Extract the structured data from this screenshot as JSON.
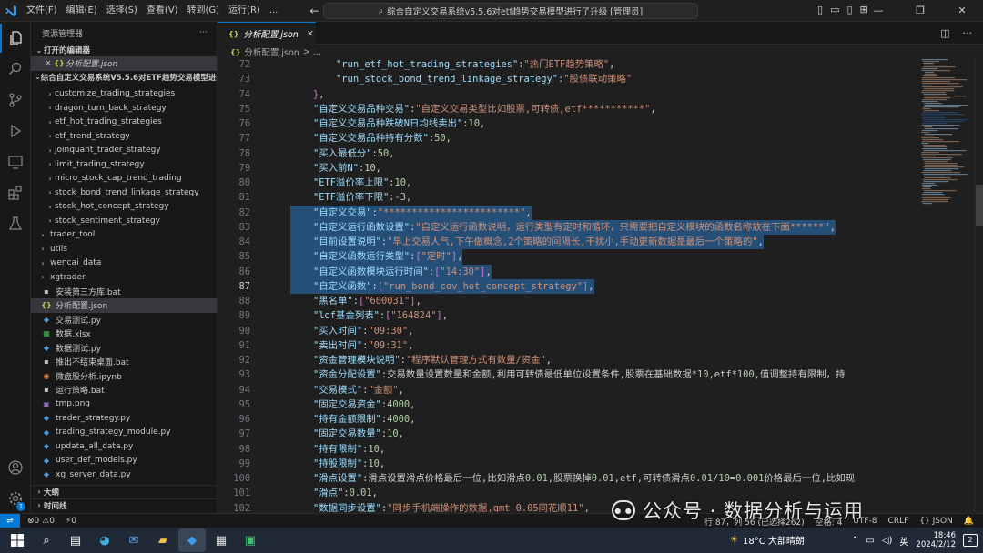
{
  "titlebar": {
    "menu": [
      "文件(F)",
      "编辑(E)",
      "选择(S)",
      "查看(V)",
      "转到(G)",
      "运行(R)",
      "..."
    ],
    "command_center": "综合自定义交易系统v5.5.6对etf趋势交易模型进行了升级 [管理员]"
  },
  "sidebar": {
    "title": "资源管理器",
    "more": "···",
    "open_editors_label": "打开的编辑器",
    "open_editor_file": "分析配置.json",
    "project_label": "综合自定义交易系统V5.5.6对ETF趋势交易模型进行了...",
    "folders": [
      "customize_trading_strategies",
      "dragon_turn_back_strategy",
      "etf_hot_trading_strategies",
      "etf_trend_strategy",
      "joinquant_trader_strategy",
      "limit_trading_strategy",
      "micro_stock_cap_trend_trading",
      "stock_bond_trend_linkage_strategy",
      "stock_hot_concept_strategy",
      "stock_sentiment_strategy"
    ],
    "root_items": [
      {
        "name": "trader_tool",
        "type": "folder"
      },
      {
        "name": "utils",
        "type": "folder"
      },
      {
        "name": "wencai_data",
        "type": "folder"
      },
      {
        "name": "xgtrader",
        "type": "folder"
      },
      {
        "name": "安装第三方库.bat",
        "type": "bat"
      },
      {
        "name": "分析配置.json",
        "type": "json"
      },
      {
        "name": "交易测试.py",
        "type": "py"
      },
      {
        "name": "数据.xlsx",
        "type": "xlsx"
      },
      {
        "name": "数据测试.py",
        "type": "py"
      },
      {
        "name": "推出不结束桌面.bat",
        "type": "bat"
      },
      {
        "name": "微盘股分析.ipynb",
        "type": "ipynb"
      },
      {
        "name": "运行策略.bat",
        "type": "bat"
      },
      {
        "name": "tmp.png",
        "type": "png"
      },
      {
        "name": "trader_strategy.py",
        "type": "py"
      },
      {
        "name": "trading_strategy_module.py",
        "type": "py"
      },
      {
        "name": "updata_all_data.py",
        "type": "py"
      },
      {
        "name": "user_def_models.py",
        "type": "py"
      },
      {
        "name": "xg_server_data.py",
        "type": "py"
      }
    ],
    "outline_label": "大纲",
    "timeline_label": "时间线"
  },
  "editor": {
    "tab_label": "分析配置.json",
    "breadcrumb_file": "分析配置.json",
    "breadcrumb_rest": "> ...",
    "lines": [
      {
        "n": "72",
        "t": "        \"run_etf_hot_trading_strategies\":\"热门ETF趋势策略\",",
        "sel": false
      },
      {
        "n": "73",
        "t": "        \"run_stock_bond_trend_linkage_strategy\":\"股债联动策略\"",
        "sel": false
      },
      {
        "n": "74",
        "t": "    },",
        "sel": false
      },
      {
        "n": "75",
        "t": "    \"自定义交易品种交易\":\"自定义交易类型比如股票,可转债,etf***********\",",
        "sel": false
      },
      {
        "n": "76",
        "t": "    \"自定义交易品种跌破N日均线卖出\":10,",
        "sel": false
      },
      {
        "n": "77",
        "t": "    \"自定义交易品种持有分数\":50,",
        "sel": false
      },
      {
        "n": "78",
        "t": "    \"买入最低分\":50,",
        "sel": false
      },
      {
        "n": "79",
        "t": "    \"买入前N\":10,",
        "sel": false
      },
      {
        "n": "80",
        "t": "    \"ETF溢价率上限\":10,",
        "sel": false
      },
      {
        "n": "81",
        "t": "    \"ETF溢价率下限\":-3,",
        "sel": false
      },
      {
        "n": "82",
        "t": "    \"自定义交易\":\"************************\",",
        "sel": true
      },
      {
        "n": "83",
        "t": "    \"自定义运行函数设置\":\"自定义运行函数说明，运行类型有定时和循环，只需要把自定义模块的函数名称放在下面******\",",
        "sel": true
      },
      {
        "n": "84",
        "t": "    \"目前设置说明\":\"早上交易人气,下午做概念,2个策略的间隔长,干扰小,手动更新数据是最后一个策略的\",",
        "sel": true
      },
      {
        "n": "85",
        "t": "    \"自定义函数运行类型\":[\"定时\"],",
        "sel": true
      },
      {
        "n": "86",
        "t": "    \"自定义函数模块运行时间\":[\"14:30\"],",
        "sel": true
      },
      {
        "n": "87",
        "t": "    \"自定义函数\":[\"run_bond_cov_hot_concept_strategy\"],",
        "sel": true
      },
      {
        "n": "88",
        "t": "    \"黑名单\":[\"600031\"],",
        "sel": false
      },
      {
        "n": "89",
        "t": "    \"lof基金列表\":[\"164824\"],",
        "sel": false
      },
      {
        "n": "90",
        "t": "    \"买入时间\":\"09:30\",",
        "sel": false
      },
      {
        "n": "91",
        "t": "    \"卖出时间\":\"09:31\",",
        "sel": false
      },
      {
        "n": "92",
        "t": "    \"资金管理模块说明\":\"程序默认管理方式有数量/资金\",",
        "sel": false
      },
      {
        "n": "93",
        "t": "    \"资金分配设置\":\"交易数量设置数量和金额,利用可转债最低单位设置条件,股票在基础数据*10,etf*100,值调整持有限制，持",
        "sel": false
      },
      {
        "n": "94",
        "t": "    \"交易模式\":\"金额\",",
        "sel": false
      },
      {
        "n": "95",
        "t": "    \"固定交易资金\":4000,",
        "sel": false
      },
      {
        "n": "96",
        "t": "    \"持有金额限制\":4000,",
        "sel": false
      },
      {
        "n": "97",
        "t": "    \"固定交易数量\":10,",
        "sel": false
      },
      {
        "n": "98",
        "t": "    \"持有限制\":10,",
        "sel": false
      },
      {
        "n": "99",
        "t": "    \"持股限制\":10,",
        "sel": false
      },
      {
        "n": "100",
        "t": "    \"滑点设置\":\"滑点设置滑点价格最后一位,比如滑点0.01,股票换掉0.01,etf,可转债滑点0.01/10=0.001价格最后一位,比如现",
        "sel": false
      },
      {
        "n": "101",
        "t": "    \"滑点\":0.01,",
        "sel": false
      },
      {
        "n": "102",
        "t": "    \"数据同步设置\":\"同步手机端操作的数据,qmt 0.05同花顺11\",",
        "sel": false
      }
    ],
    "current_line": "87"
  },
  "statusbar": {
    "errors": "⊗0 ⚠0",
    "ports": "⚡0",
    "cursor": "行 87，列 56 (已选择262)",
    "spaces": "空格: 4",
    "encoding": "UTF-8",
    "eol": "CRLF",
    "language": "{} JSON"
  },
  "taskbar": {
    "weather": "18°C  大部晴朗",
    "ime": "英",
    "time": "18:46",
    "date": "2024/2/12",
    "notifications": "2"
  },
  "watermark": {
    "text": "公众号 · 数据分析与运用"
  }
}
